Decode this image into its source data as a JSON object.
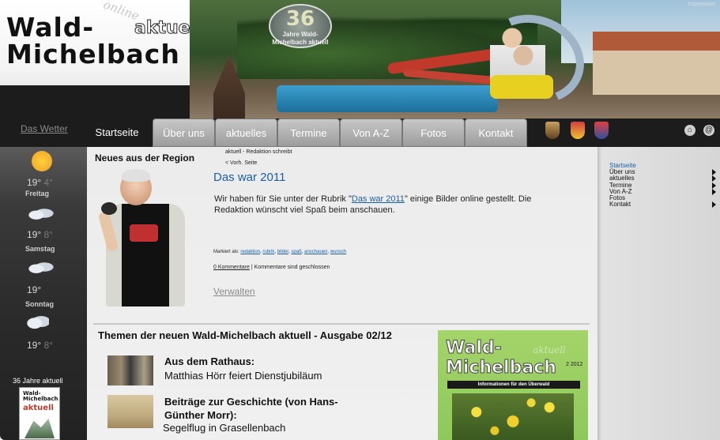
{
  "logo": {
    "line1": "Wald-",
    "online": "online",
    "aktuell": "aktuell",
    "line2": "Michelbach"
  },
  "badge": {
    "number": "36",
    "text": "Jahre Wald-Michelbach aktuell"
  },
  "header": {
    "impressum": "Impressum"
  },
  "nav": {
    "weather_link": "Das Wetter",
    "tabs": [
      "Startseite",
      "Über uns",
      "aktuelles",
      "Termine",
      "Von A-Z",
      "Fotos",
      "Kontakt"
    ]
  },
  "weather": [
    {
      "icon": "sun-icon",
      "high": "19°",
      "low": "4°",
      "day": "Freitag"
    },
    {
      "icon": "cloudy-icon",
      "high": "19°",
      "low": "8°",
      "day": "Samstag"
    },
    {
      "icon": "cloudy-icon",
      "high": "19°",
      "low": "",
      "day": "Sonntag"
    },
    {
      "icon": "rain-icon",
      "high": "19°",
      "low": "8°",
      "day": ""
    }
  ],
  "promo": {
    "label": "36 Jahre aktuell",
    "wald": "Wald-Michelbach",
    "aktuell": "aktuell"
  },
  "main": {
    "region_title": "Neues aus der Region",
    "breadcrumb": "aktuell - Redaktion schreibt",
    "prev": "< Vorh. Seite",
    "article_title": "Das war 2011",
    "body_pre": "Wir haben für Sie unter der Rubrik \"",
    "body_link": "Das war 2011",
    "body_post": "\" einige Bilder online gestellt. Die Redaktion wünscht viel Spaß beim anschauen.",
    "tags_label": "Markiert als:",
    "tags": [
      "redaktion",
      "rubrik",
      "bilder",
      "spaß",
      "anschauen",
      "wunsch"
    ],
    "comments_count": "0 Kommentare",
    "comments_sep": "|",
    "comments_closed": "Kommentare sind geschlossen",
    "manage": "Verwalten",
    "themen_title": "Themen der neuen Wald-Michelbach aktuell - Ausgabe 02/12",
    "topic1_title": "Aus dem Rathaus:",
    "topic1_sub": "Matthias Hörr feiert Dienstjubiläum",
    "topic2_title": "Beiträge zur Geschichte (von Hans-Günther Morr):",
    "topic2_sub": "Segelflug in Grasellenbach"
  },
  "cover": {
    "wald": "Wald-",
    "aktuell": "aktuell",
    "michel": "Michelbach",
    "issue": "2 2012",
    "strip": "Informationen für den Überwald"
  },
  "sidebar": {
    "items": [
      "Startseite",
      "Über uns",
      "aktuelles",
      "Termine",
      "Von A-Z",
      "Fotos",
      "Kontakt"
    ],
    "arrows": [
      false,
      true,
      true,
      true,
      true,
      false,
      true
    ]
  },
  "colors": {
    "accent": "#1a5fa8",
    "dark": "#1c1c1c"
  }
}
